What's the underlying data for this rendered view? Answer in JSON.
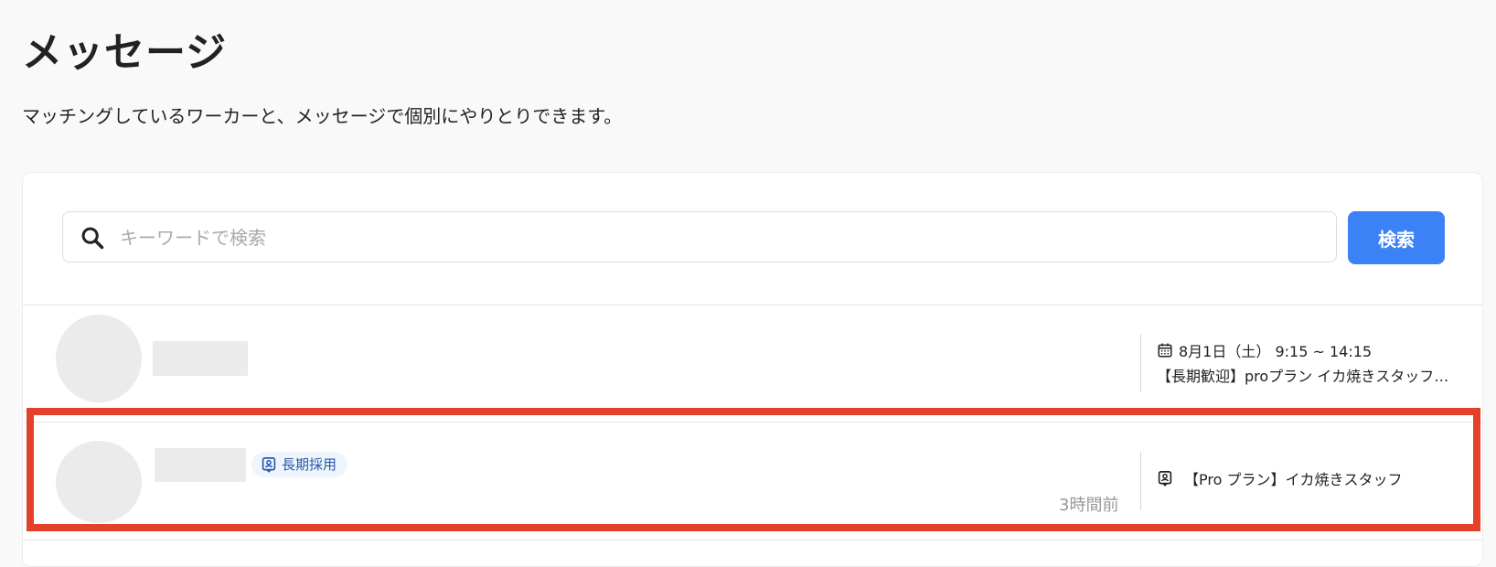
{
  "header": {
    "title": "メッセージ",
    "description": "マッチングしているワーカーと、メッセージで個別にやりとりできます。"
  },
  "search": {
    "placeholder": "キーワードで検索",
    "button_label": "検索"
  },
  "conversations": [
    {
      "schedule": "8月1日（土） 9:15 ~ 14:15",
      "job_title": "【長期歓迎】proプラン イカ焼きスタッフ募..."
    },
    {
      "tag": "長期採用",
      "timestamp": "3時間前",
      "job_title": "【Pro プラン】イカ焼きスタッフ"
    }
  ],
  "colors": {
    "accent": "#3b82f6",
    "highlight": "#e5412a",
    "tag_text": "#2a56a8",
    "tag_bg": "#eef5fd"
  }
}
